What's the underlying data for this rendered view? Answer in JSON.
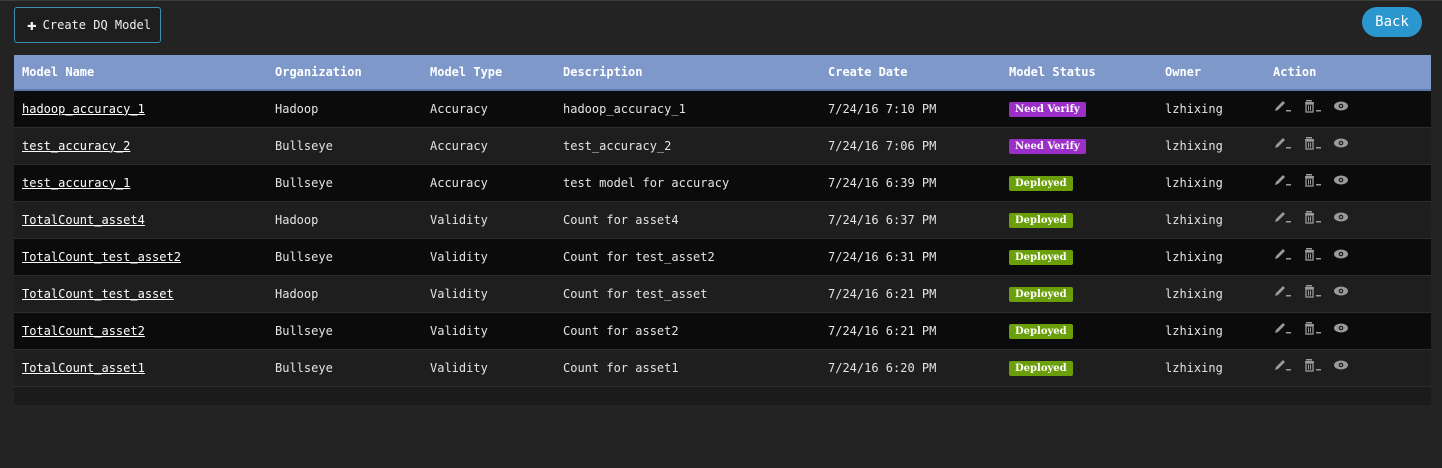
{
  "toolbar": {
    "create_label": "Create DQ Model",
    "back_label": "Back"
  },
  "colors": {
    "need_verify": "#9b30c8",
    "deployed": "#6a9f0a",
    "header_bg": "#7e98c9",
    "back_button": "#2b97cf"
  },
  "table": {
    "headers": [
      "Model Name",
      "Organization",
      "Model Type",
      "Description",
      "Create Date",
      "Model Status",
      "Owner",
      "Action"
    ],
    "rows": [
      {
        "name": "hadoop_accuracy_1",
        "org": "Hadoop",
        "type": "Accuracy",
        "desc": "hadoop_accuracy_1",
        "date": "7/24/16 7:10 PM",
        "status": "Need Verify",
        "owner": "lzhixing"
      },
      {
        "name": "test_accuracy_2",
        "org": "Bullseye",
        "type": "Accuracy",
        "desc": "test_accuracy_2",
        "date": "7/24/16 7:06 PM",
        "status": "Need Verify",
        "owner": "lzhixing"
      },
      {
        "name": "test_accuracy_1",
        "org": "Bullseye",
        "type": "Accuracy",
        "desc": "test model for accuracy",
        "date": "7/24/16 6:39 PM",
        "status": "Deployed",
        "owner": "lzhixing"
      },
      {
        "name": "TotalCount_asset4",
        "org": "Hadoop",
        "type": "Validity",
        "desc": "Count for asset4",
        "date": "7/24/16 6:37 PM",
        "status": "Deployed",
        "owner": "lzhixing"
      },
      {
        "name": "TotalCount_test_asset2",
        "org": "Bullseye",
        "type": "Validity",
        "desc": "Count for test_asset2",
        "date": "7/24/16 6:31 PM",
        "status": "Deployed",
        "owner": "lzhixing"
      },
      {
        "name": "TotalCount_test_asset",
        "org": "Hadoop",
        "type": "Validity",
        "desc": "Count for test_asset",
        "date": "7/24/16 6:21 PM",
        "status": "Deployed",
        "owner": "lzhixing"
      },
      {
        "name": "TotalCount_asset2",
        "org": "Bullseye",
        "type": "Validity",
        "desc": "Count for asset2",
        "date": "7/24/16 6:21 PM",
        "status": "Deployed",
        "owner": "lzhixing"
      },
      {
        "name": "TotalCount_asset1",
        "org": "Bullseye",
        "type": "Validity",
        "desc": "Count for asset1",
        "date": "7/24/16 6:20 PM",
        "status": "Deployed",
        "owner": "lzhixing"
      }
    ],
    "action_icons": [
      "pencil-icon",
      "trash-icon",
      "eye-icon"
    ]
  }
}
